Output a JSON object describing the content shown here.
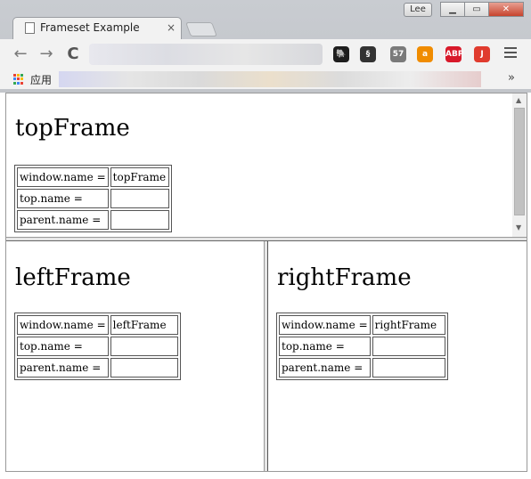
{
  "window": {
    "user_badge": "Lee",
    "minimize": "▁",
    "maximize": "▭",
    "close": "✕"
  },
  "tab": {
    "title": "Frameset Example",
    "close_label": "×"
  },
  "toolbar": {
    "back": "←",
    "forward": "→",
    "reload": "C",
    "extensions": [
      {
        "name": "evernote-icon",
        "color": "#1e1e1e",
        "label": "🐘"
      },
      {
        "name": "gesture-icon",
        "color": "#333333",
        "label": "§"
      },
      {
        "name": "mail-checker-icon",
        "color": "#7a7a7a",
        "label": "57"
      },
      {
        "name": "amazon-icon",
        "color": "#f08c00",
        "label": "a"
      },
      {
        "name": "adblock-plus-icon",
        "color": "#d8192a",
        "label": "ABP"
      },
      {
        "name": "red-extension-icon",
        "color": "#e03b2e",
        "label": "J"
      }
    ]
  },
  "bookmarks": {
    "apps_label": "应用",
    "more": "»"
  },
  "frames": {
    "top": {
      "heading": "topFrame",
      "rows": [
        {
          "label": "window.name =",
          "value": "topFrame"
        },
        {
          "label": "top.name =",
          "value": ""
        },
        {
          "label": "parent.name =",
          "value": ""
        }
      ]
    },
    "left": {
      "heading": "leftFrame",
      "rows": [
        {
          "label": "window.name =",
          "value": "leftFrame"
        },
        {
          "label": "top.name =",
          "value": ""
        },
        {
          "label": "parent.name =",
          "value": ""
        }
      ]
    },
    "right": {
      "heading": "rightFrame",
      "rows": [
        {
          "label": "window.name =",
          "value": "rightFrame"
        },
        {
          "label": "top.name =",
          "value": ""
        },
        {
          "label": "parent.name =",
          "value": ""
        }
      ]
    }
  },
  "scrollbar": {
    "up": "▲",
    "down": "▼"
  }
}
